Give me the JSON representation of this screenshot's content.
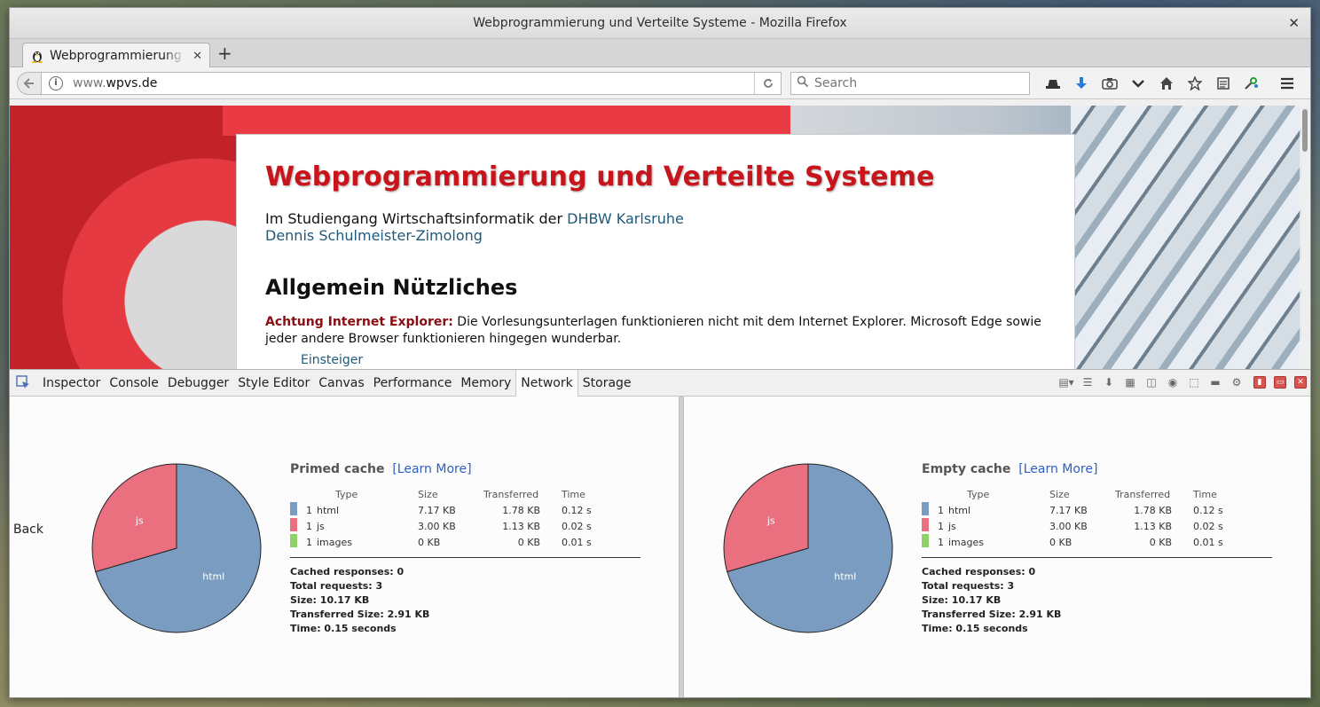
{
  "window": {
    "title": "Webprogrammierung und Verteilte Systeme - Mozilla Firefox",
    "close_label": "✕"
  },
  "tab": {
    "title": "Webprogrammierung und Verteilte Systeme",
    "close_label": "✕",
    "new_tab_label": "+"
  },
  "navbar": {
    "url_dim": "www.",
    "url_main": "wpvs.de",
    "search_placeholder": "Search"
  },
  "page": {
    "title": "Webprogrammierung und Verteilte Systeme",
    "subtitle_prefix": "Im Studiengang Wirtschaftsinformatik der ",
    "subtitle_link": "DHBW Karlsruhe",
    "author_link": "Dennis Schulmeister-Zimolong",
    "section_heading": "Allgemein Nützliches",
    "notice_bold": "Achtung Internet Explorer:",
    "notice_text": " Die Vorlesungsunterlagen funktionieren nicht mit dem Internet Explorer. Microsoft Edge sowie jeder andere Browser funktionieren hingegen wunderbar.",
    "cutoff_link": "Einsteiger"
  },
  "devtools": {
    "tabs": [
      "Inspector",
      "Console",
      "Debugger",
      "Style Editor",
      "Canvas",
      "Performance",
      "Memory",
      "Network",
      "Storage"
    ],
    "active_tab": "Network",
    "back_label": "Back",
    "colors": {
      "html": "#7a9cc0",
      "js": "#ea707f",
      "images": "#8ed06a"
    }
  },
  "primed": {
    "heading": "Primed cache",
    "learn_more": "[Learn More]",
    "columns": [
      "Type",
      "Size",
      "Transferred",
      "Time"
    ],
    "rows": [
      {
        "count": "1",
        "type": "html",
        "size": "7.17 KB",
        "transferred": "1.78 KB",
        "time": "0.12 s"
      },
      {
        "count": "1",
        "type": "js",
        "size": "3.00 KB",
        "transferred": "1.13 KB",
        "time": "0.02 s"
      },
      {
        "count": "1",
        "type": "images",
        "size": "0 KB",
        "transferred": "0 KB",
        "time": "0.01 s"
      }
    ],
    "cached_responses": "Cached responses: 0",
    "total_requests": "Total requests: 3",
    "size": "Size: 10.17 KB",
    "transferred_size": "Transferred Size: 2.91 KB",
    "time": "Time: 0.15 seconds",
    "pie_html_label": "html",
    "pie_js_label": "js"
  },
  "empty": {
    "heading": "Empty cache",
    "learn_more": "[Learn More]",
    "columns": [
      "Type",
      "Size",
      "Transferred",
      "Time"
    ],
    "rows": [
      {
        "count": "1",
        "type": "html",
        "size": "7.17 KB",
        "transferred": "1.78 KB",
        "time": "0.12 s"
      },
      {
        "count": "1",
        "type": "js",
        "size": "3.00 KB",
        "transferred": "1.13 KB",
        "time": "0.02 s"
      },
      {
        "count": "1",
        "type": "images",
        "size": "0 KB",
        "transferred": "0 KB",
        "time": "0.01 s"
      }
    ],
    "cached_responses": "Cached responses: 0",
    "total_requests": "Total requests: 3",
    "size": "Size: 10.17 KB",
    "transferred_size": "Transferred Size: 2.91 KB",
    "time": "Time: 0.15 seconds",
    "pie_html_label": "html",
    "pie_js_label": "js"
  },
  "chart_data": [
    {
      "type": "pie",
      "title": "",
      "categories": [
        "html",
        "js"
      ],
      "values": [
        7.17,
        3.0
      ]
    },
    {
      "type": "pie",
      "title": "",
      "categories": [
        "html",
        "js"
      ],
      "values": [
        7.17,
        3.0
      ]
    }
  ]
}
